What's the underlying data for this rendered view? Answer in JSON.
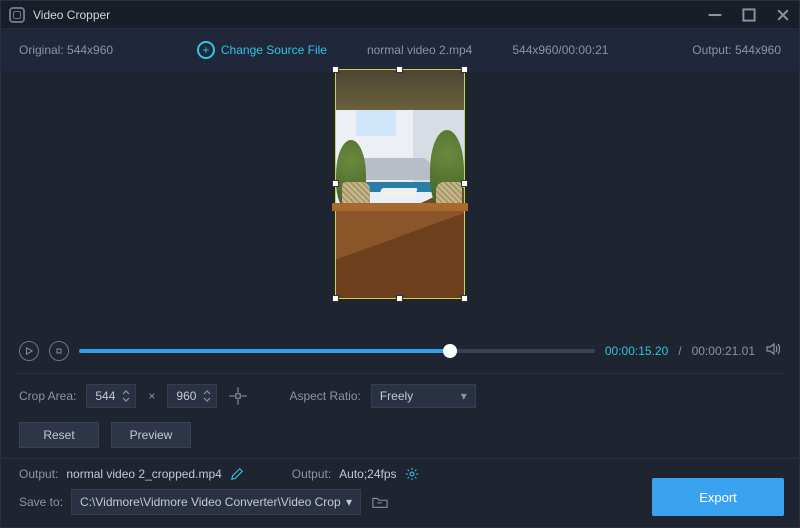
{
  "window": {
    "title": "Video Cropper"
  },
  "top": {
    "original_label": "Original:",
    "original_value": "544x960",
    "change_source": "Change Source File",
    "filename": "normal video 2.mp4",
    "dims_dur": "544x960/00:00:21",
    "output_label": "Output:",
    "output_value": "544x960"
  },
  "player": {
    "current_time": "00:00:15.20",
    "duration": "00:00:21.01"
  },
  "crop": {
    "area_label": "Crop Area:",
    "width": "544",
    "height": "960",
    "aspect_label": "Aspect Ratio:",
    "aspect_value": "Freely",
    "reset": "Reset",
    "preview": "Preview"
  },
  "output": {
    "label": "Output:",
    "filename": "normal video 2_cropped.mp4",
    "fmt_label": "Output:",
    "fmt_value": "Auto;24fps"
  },
  "save": {
    "label": "Save to:",
    "path": "C:\\Vidmore\\Vidmore Video Converter\\Video Crop"
  },
  "export": {
    "label": "Export"
  }
}
